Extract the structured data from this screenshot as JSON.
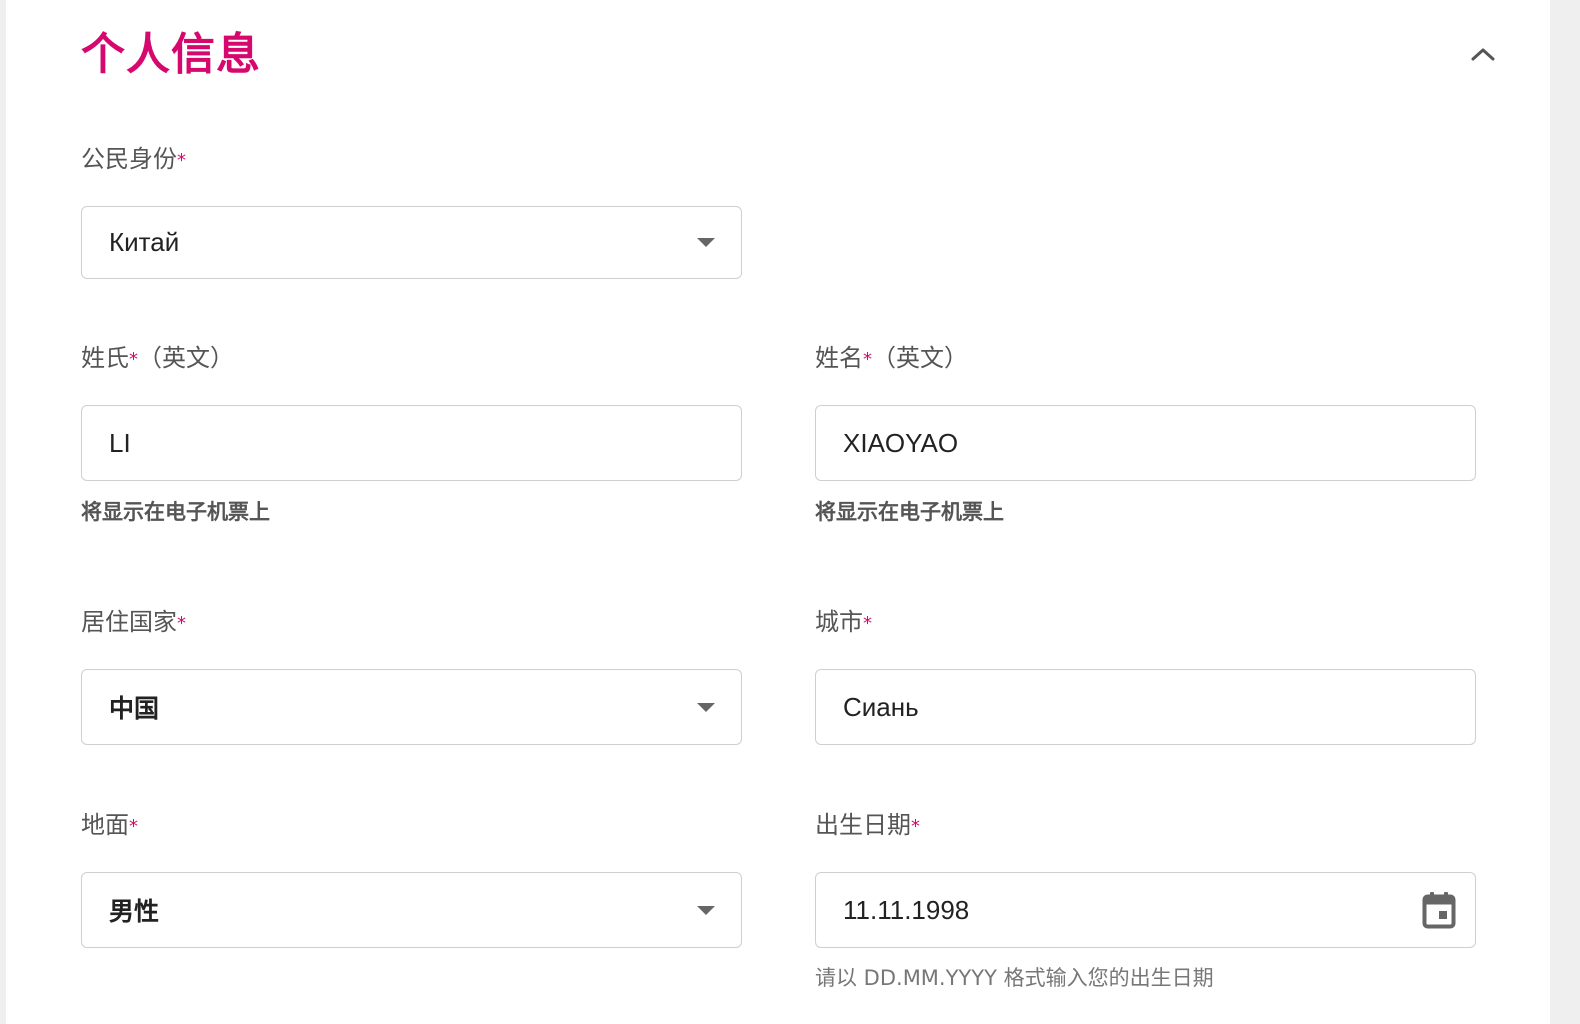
{
  "section": {
    "title": "个人信息"
  },
  "citizenship": {
    "label": "公民身份",
    "required": "*",
    "value": "Китай"
  },
  "last_name": {
    "label": "姓氏",
    "required": "*",
    "label_suffix": "（英文）",
    "value": "LI",
    "hint": "将显示在电子机票上"
  },
  "first_name": {
    "label": "姓名",
    "required": "*",
    "label_suffix": "（英文）",
    "value": "XIAOYAO",
    "hint": "将显示在电子机票上"
  },
  "residence_country": {
    "label": "居住国家",
    "required": "*",
    "value": "中国"
  },
  "city": {
    "label": "城市",
    "required": "*",
    "value": "Сиань"
  },
  "gender": {
    "label": "地面",
    "required": "*",
    "value": "男性"
  },
  "birth_date": {
    "label": "出生日期",
    "required": "*",
    "value": "11.11.1998",
    "hint": "请以 DD.MM.YYYY 格式输入您的出生日期"
  },
  "icons": {
    "collapse": "chevron-up-icon",
    "dropdown": "caret-down-icon",
    "calendar": "calendar-icon"
  },
  "colors": {
    "accent": "#d6086d",
    "label": "#555555",
    "border": "#cfcfcf"
  }
}
